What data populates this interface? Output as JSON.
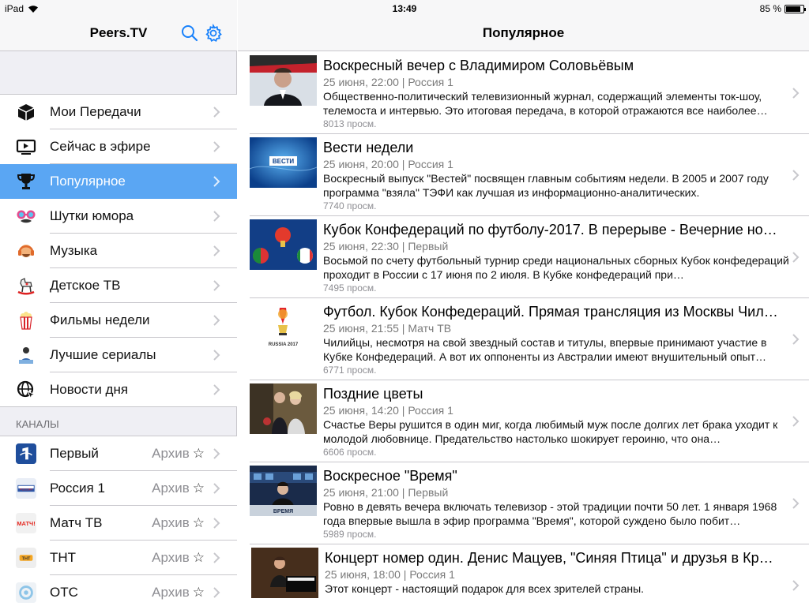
{
  "status": {
    "device": "iPad",
    "time": "13:49",
    "battery": "85 %",
    "battery_level": 0.85
  },
  "sidebar": {
    "title": "Peers.TV",
    "menu": [
      {
        "label": "Мои Передачи",
        "icon": "box-icon"
      },
      {
        "label": "Сейчас в эфире",
        "icon": "tv-play-icon"
      },
      {
        "label": "Популярное",
        "icon": "trophy-icon",
        "active": true
      },
      {
        "label": "Шутки юмора",
        "icon": "funny-glasses-icon"
      },
      {
        "label": "Музыка",
        "icon": "headphones-face-icon"
      },
      {
        "label": "Детское ТВ",
        "icon": "rocking-horse-icon"
      },
      {
        "label": "Фильмы недели",
        "icon": "popcorn-icon"
      },
      {
        "label": "Лучшие сериалы",
        "icon": "series-person-icon"
      },
      {
        "label": "Новости дня",
        "icon": "globe-cursor-icon"
      }
    ],
    "channels_header": "КАНАЛЫ",
    "channels": [
      {
        "name": "Первый",
        "archive": "Архив",
        "logo_color": "#1f4e9c"
      },
      {
        "name": "Россия 1",
        "archive": "Архив",
        "logo_color": "#e9eef6"
      },
      {
        "name": "Матч ТВ",
        "archive": "Архив",
        "logo_color": "#f1f1f1"
      },
      {
        "name": "ТНТ",
        "archive": "Архив",
        "logo_color": "#eeeeee"
      },
      {
        "name": "ОТС",
        "archive": "Архив",
        "logo_color": "#eef2f6"
      }
    ]
  },
  "detail": {
    "title": "Популярное",
    "items": [
      {
        "title": "Воскресный вечер с Владимиром Соловьёвым",
        "meta": "25 июня, 22:00 | Россия 1",
        "desc": "Общественно-политический телевизионный журнал, содержащий элементы ток-шоу, телемоста и интервью. Это итоговая передача, в которой отражаются все наиболее…",
        "views": "8013 просм."
      },
      {
        "title": "Вести недели",
        "meta": "25 июня, 20:00 | Россия 1",
        "desc": "Воскресный выпуск \"Вестей\" посвящен главным событиям недели. В 2005 и 2007 году программа \"взяла\" ТЭФИ как лучшая из информационно-аналитических.",
        "views": "7740 просм."
      },
      {
        "title": "Кубок Конфедераций по футболу-2017. В перерыве - Вечерние но…",
        "meta": "25 июня, 22:30 | Первый",
        "desc": "Восьмой по счету футбольный турнир среди национальных сборных Кубок конфедераций проходит в России с 17 июня по 2 июля. В Кубке конфедераций при…",
        "views": "7495 просм."
      },
      {
        "title": "Футбол. Кубок Конфедераций. Прямая трансляция из Москвы Чил…",
        "meta": "25 июня, 21:55 | Матч ТВ",
        "desc": "Чилийцы, несмотря на свой звездный состав и титулы, впервые принимают участие в Кубке Конфедераций. А вот их оппоненты из Австралии имеют внушительный опыт…",
        "views": "6771 просм."
      },
      {
        "title": "Поздние цветы",
        "meta": "25 июня, 14:20 | Россия 1",
        "desc": "Счастье Веры рушится в один миг, когда любимый муж после долгих лет брака уходит к молодой любовнице. Предательство настолько шокирует героиню, что она…",
        "views": "6606 просм."
      },
      {
        "title": "Воскресное \"Время\"",
        "meta": "25 июня, 21:00 | Первый",
        "desc": "Ровно в девять вечера включать телевизор - этой традиции почти 50 лет. 1 января 1968 года впервые вышла в эфир программа \"Время\", которой суждено было побит…",
        "views": "5989 просм."
      },
      {
        "title": "Концерт номер один. Денис Мацуев, \"Синяя Птица\" и друзья в Кр…",
        "meta": "25 июня, 18:00 | Россия 1",
        "desc": "Этот концерт - настоящий подарок для всех зрителей страны.",
        "views": ""
      }
    ],
    "thumb_texts": {
      "vesti": "ВЕСТИ",
      "russia": "RUSSIA 2017",
      "time": "ВРЕМЯ"
    }
  }
}
